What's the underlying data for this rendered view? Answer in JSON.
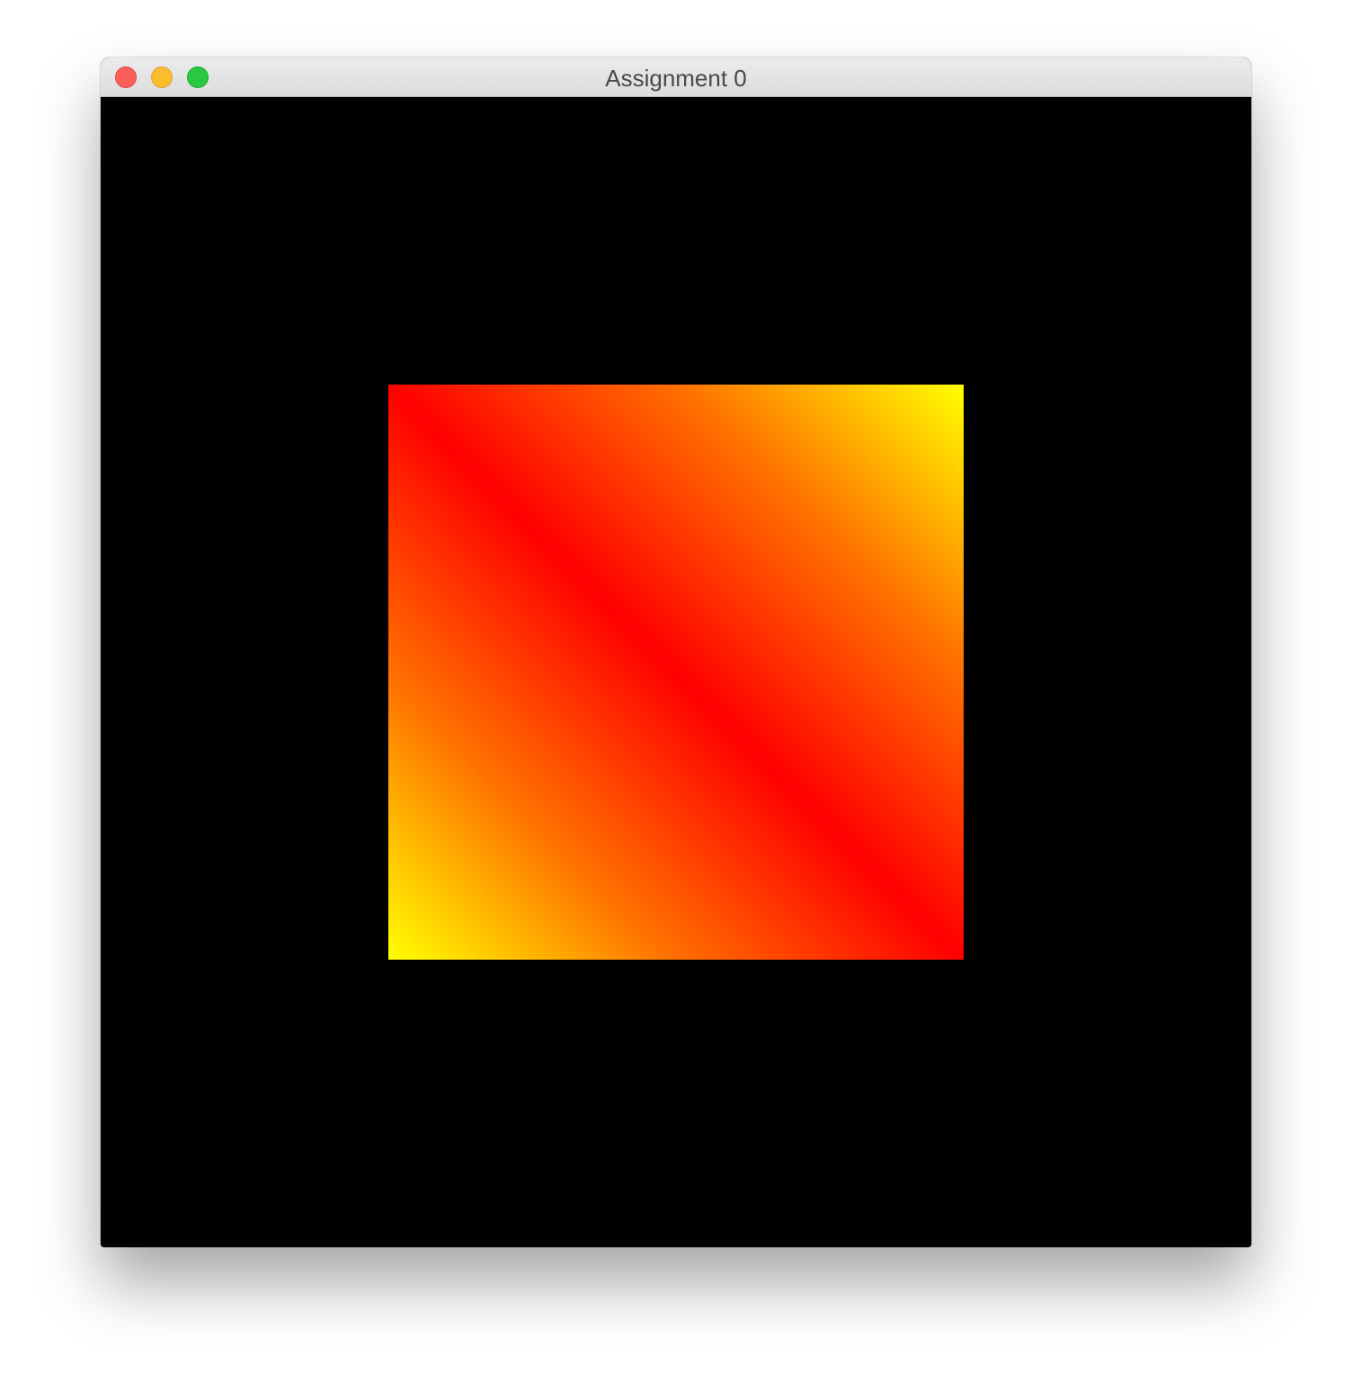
{
  "window": {
    "title": "Assignment 0",
    "controls": {
      "close_color": "#fc5f57",
      "minimize_color": "#fdbc2e",
      "zoom_color": "#28c840"
    }
  },
  "canvas": {
    "background": "#000000",
    "square": {
      "gradient_colors": [
        "#ffff00",
        "#ff0000",
        "#ffff00"
      ]
    }
  }
}
